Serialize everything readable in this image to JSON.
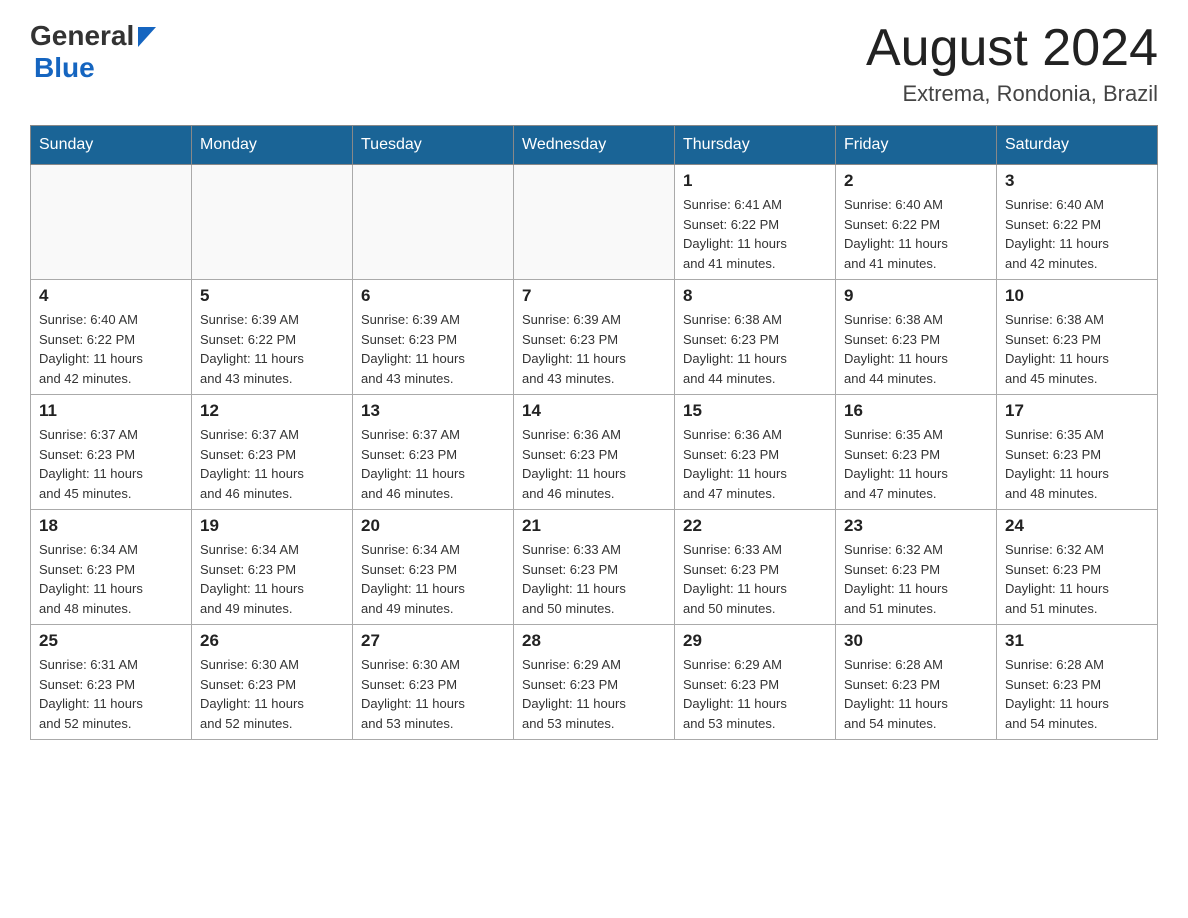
{
  "header": {
    "logo_general": "General",
    "logo_blue": "Blue",
    "title": "August 2024",
    "subtitle": "Extrema, Rondonia, Brazil"
  },
  "days_of_week": [
    "Sunday",
    "Monday",
    "Tuesday",
    "Wednesday",
    "Thursday",
    "Friday",
    "Saturday"
  ],
  "weeks": [
    {
      "cells": [
        {
          "day": "",
          "info": ""
        },
        {
          "day": "",
          "info": ""
        },
        {
          "day": "",
          "info": ""
        },
        {
          "day": "",
          "info": ""
        },
        {
          "day": "1",
          "info": "Sunrise: 6:41 AM\nSunset: 6:22 PM\nDaylight: 11 hours\nand 41 minutes."
        },
        {
          "day": "2",
          "info": "Sunrise: 6:40 AM\nSunset: 6:22 PM\nDaylight: 11 hours\nand 41 minutes."
        },
        {
          "day": "3",
          "info": "Sunrise: 6:40 AM\nSunset: 6:22 PM\nDaylight: 11 hours\nand 42 minutes."
        }
      ]
    },
    {
      "cells": [
        {
          "day": "4",
          "info": "Sunrise: 6:40 AM\nSunset: 6:22 PM\nDaylight: 11 hours\nand 42 minutes."
        },
        {
          "day": "5",
          "info": "Sunrise: 6:39 AM\nSunset: 6:22 PM\nDaylight: 11 hours\nand 43 minutes."
        },
        {
          "day": "6",
          "info": "Sunrise: 6:39 AM\nSunset: 6:23 PM\nDaylight: 11 hours\nand 43 minutes."
        },
        {
          "day": "7",
          "info": "Sunrise: 6:39 AM\nSunset: 6:23 PM\nDaylight: 11 hours\nand 43 minutes."
        },
        {
          "day": "8",
          "info": "Sunrise: 6:38 AM\nSunset: 6:23 PM\nDaylight: 11 hours\nand 44 minutes."
        },
        {
          "day": "9",
          "info": "Sunrise: 6:38 AM\nSunset: 6:23 PM\nDaylight: 11 hours\nand 44 minutes."
        },
        {
          "day": "10",
          "info": "Sunrise: 6:38 AM\nSunset: 6:23 PM\nDaylight: 11 hours\nand 45 minutes."
        }
      ]
    },
    {
      "cells": [
        {
          "day": "11",
          "info": "Sunrise: 6:37 AM\nSunset: 6:23 PM\nDaylight: 11 hours\nand 45 minutes."
        },
        {
          "day": "12",
          "info": "Sunrise: 6:37 AM\nSunset: 6:23 PM\nDaylight: 11 hours\nand 46 minutes."
        },
        {
          "day": "13",
          "info": "Sunrise: 6:37 AM\nSunset: 6:23 PM\nDaylight: 11 hours\nand 46 minutes."
        },
        {
          "day": "14",
          "info": "Sunrise: 6:36 AM\nSunset: 6:23 PM\nDaylight: 11 hours\nand 46 minutes."
        },
        {
          "day": "15",
          "info": "Sunrise: 6:36 AM\nSunset: 6:23 PM\nDaylight: 11 hours\nand 47 minutes."
        },
        {
          "day": "16",
          "info": "Sunrise: 6:35 AM\nSunset: 6:23 PM\nDaylight: 11 hours\nand 47 minutes."
        },
        {
          "day": "17",
          "info": "Sunrise: 6:35 AM\nSunset: 6:23 PM\nDaylight: 11 hours\nand 48 minutes."
        }
      ]
    },
    {
      "cells": [
        {
          "day": "18",
          "info": "Sunrise: 6:34 AM\nSunset: 6:23 PM\nDaylight: 11 hours\nand 48 minutes."
        },
        {
          "day": "19",
          "info": "Sunrise: 6:34 AM\nSunset: 6:23 PM\nDaylight: 11 hours\nand 49 minutes."
        },
        {
          "day": "20",
          "info": "Sunrise: 6:34 AM\nSunset: 6:23 PM\nDaylight: 11 hours\nand 49 minutes."
        },
        {
          "day": "21",
          "info": "Sunrise: 6:33 AM\nSunset: 6:23 PM\nDaylight: 11 hours\nand 50 minutes."
        },
        {
          "day": "22",
          "info": "Sunrise: 6:33 AM\nSunset: 6:23 PM\nDaylight: 11 hours\nand 50 minutes."
        },
        {
          "day": "23",
          "info": "Sunrise: 6:32 AM\nSunset: 6:23 PM\nDaylight: 11 hours\nand 51 minutes."
        },
        {
          "day": "24",
          "info": "Sunrise: 6:32 AM\nSunset: 6:23 PM\nDaylight: 11 hours\nand 51 minutes."
        }
      ]
    },
    {
      "cells": [
        {
          "day": "25",
          "info": "Sunrise: 6:31 AM\nSunset: 6:23 PM\nDaylight: 11 hours\nand 52 minutes."
        },
        {
          "day": "26",
          "info": "Sunrise: 6:30 AM\nSunset: 6:23 PM\nDaylight: 11 hours\nand 52 minutes."
        },
        {
          "day": "27",
          "info": "Sunrise: 6:30 AM\nSunset: 6:23 PM\nDaylight: 11 hours\nand 53 minutes."
        },
        {
          "day": "28",
          "info": "Sunrise: 6:29 AM\nSunset: 6:23 PM\nDaylight: 11 hours\nand 53 minutes."
        },
        {
          "day": "29",
          "info": "Sunrise: 6:29 AM\nSunset: 6:23 PM\nDaylight: 11 hours\nand 53 minutes."
        },
        {
          "day": "30",
          "info": "Sunrise: 6:28 AM\nSunset: 6:23 PM\nDaylight: 11 hours\nand 54 minutes."
        },
        {
          "day": "31",
          "info": "Sunrise: 6:28 AM\nSunset: 6:23 PM\nDaylight: 11 hours\nand 54 minutes."
        }
      ]
    }
  ]
}
